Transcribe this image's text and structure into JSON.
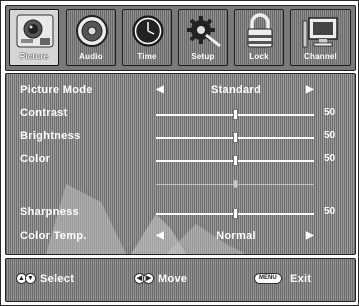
{
  "tabs": [
    {
      "label": "Picture",
      "icon": "picture-camera-icon",
      "active": true
    },
    {
      "label": "Audio",
      "icon": "speaker-icon",
      "active": false
    },
    {
      "label": "Time",
      "icon": "clock-icon",
      "active": false
    },
    {
      "label": "Setup",
      "icon": "gear-wrench-icon",
      "active": false
    },
    {
      "label": "Lock",
      "icon": "padlock-icon",
      "active": false
    },
    {
      "label": "Channel",
      "icon": "monitor-icon",
      "active": false
    }
  ],
  "settings": {
    "picture_mode": {
      "label": "Picture Mode",
      "value": "Standard"
    },
    "contrast": {
      "label": "Contrast",
      "value": "50",
      "level": 0.5
    },
    "brightness": {
      "label": "Brightness",
      "value": "50",
      "level": 0.5
    },
    "color": {
      "label": "Color",
      "value": "50",
      "level": 0.5
    },
    "tint": {
      "level": 0.5
    },
    "sharpness": {
      "label": "Sharpness",
      "value": "50",
      "level": 0.5
    },
    "color_temp": {
      "label": "Color Temp.",
      "value": "Normal"
    }
  },
  "footer": {
    "select": {
      "label": "Select",
      "keys": [
        "up-arrow-key-icon",
        "down-arrow-key-icon"
      ]
    },
    "move": {
      "label": "Move",
      "keys": [
        "left-arrow-key-icon",
        "right-arrow-key-icon"
      ]
    },
    "exit": {
      "label": "Exit",
      "key": "MENU"
    }
  },
  "colors": {
    "highlight_text": "#ffffff",
    "frame": "#222222"
  }
}
